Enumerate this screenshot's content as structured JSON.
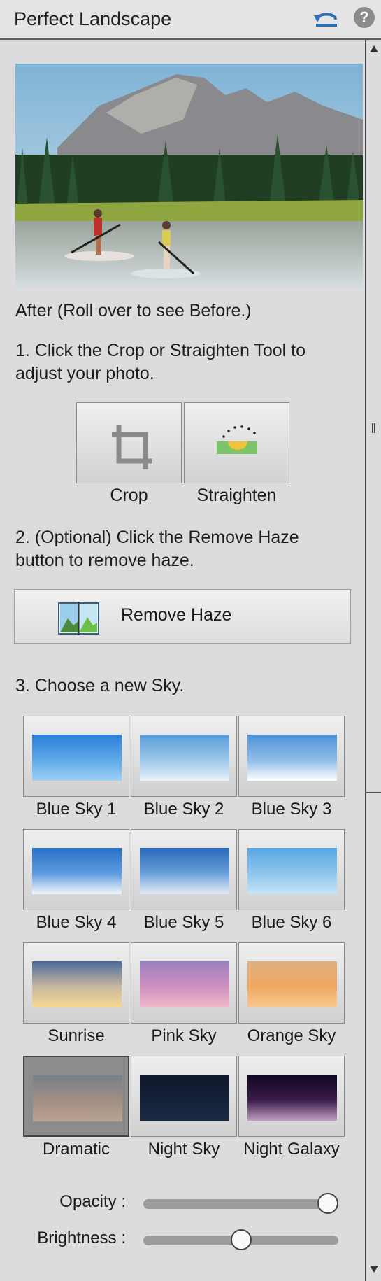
{
  "panel": {
    "title": "Perfect Landscape"
  },
  "preview": {
    "caption": "After (Roll over to see Before.)"
  },
  "step1": {
    "text_line1": "1. Click the Crop or Straighten Tool to",
    "text_line2": "adjust your photo.",
    "crop_label": "Crop",
    "straighten_label": "Straighten"
  },
  "step2": {
    "text_line1": "2. (Optional) Click the Remove Haze",
    "text_line2": "button to remove haze.",
    "remove_haze_label": "Remove Haze"
  },
  "step3": {
    "text": "3. Choose a new Sky.",
    "skies": [
      {
        "label": "Blue Sky 1",
        "selected": false
      },
      {
        "label": "Blue Sky 2",
        "selected": false
      },
      {
        "label": "Blue Sky 3",
        "selected": false
      },
      {
        "label": "Blue Sky 4",
        "selected": false
      },
      {
        "label": "Blue Sky 5",
        "selected": false
      },
      {
        "label": "Blue Sky 6",
        "selected": false
      },
      {
        "label": "Sunrise",
        "selected": false
      },
      {
        "label": "Pink Sky",
        "selected": false
      },
      {
        "label": "Orange Sky",
        "selected": false
      },
      {
        "label": "Dramatic",
        "selected": true
      },
      {
        "label": "Night Sky",
        "selected": false
      },
      {
        "label": "Night Galaxy",
        "selected": false
      }
    ]
  },
  "sliders": {
    "opacity": {
      "label": "Opacity :",
      "value": 1.0
    },
    "brightness": {
      "label": "Brightness :",
      "value": 0.5
    }
  }
}
